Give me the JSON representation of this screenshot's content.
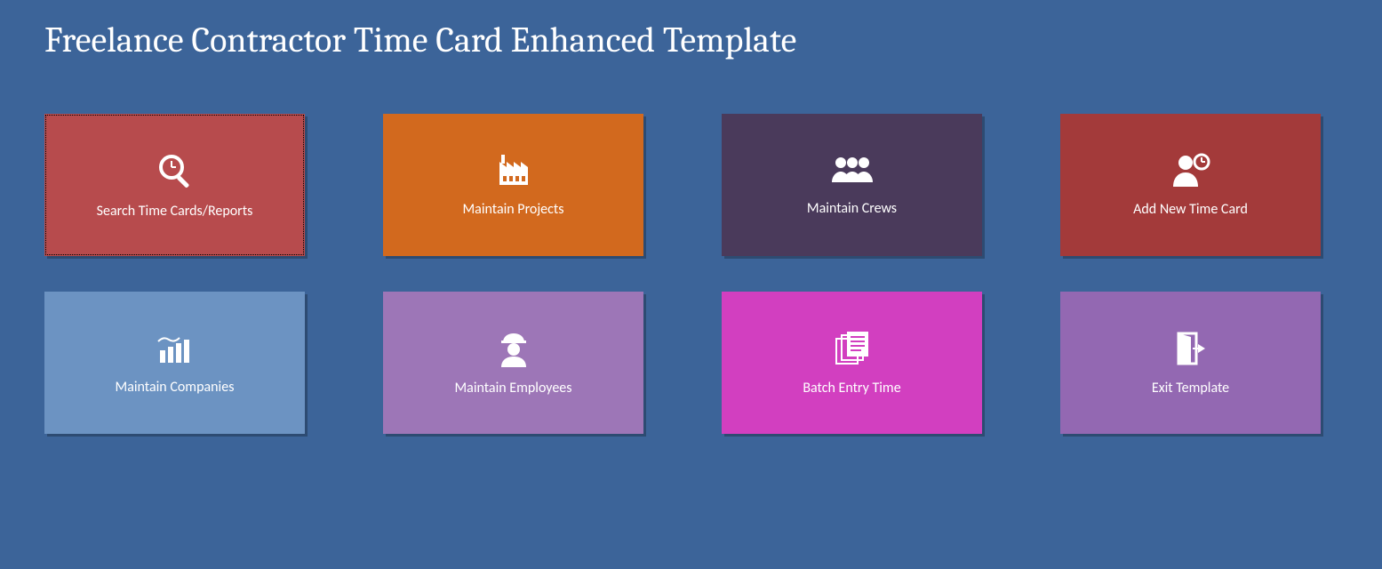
{
  "title": "Freelance Contractor Time Card Enhanced Template",
  "tiles": {
    "search": {
      "label": "Search Time Cards/Reports"
    },
    "projects": {
      "label": "Maintain Projects"
    },
    "crews": {
      "label": "Maintain Crews"
    },
    "newcard": {
      "label": "Add New Time Card"
    },
    "companies": {
      "label": "Maintain Companies"
    },
    "employees": {
      "label": "Maintain Employees"
    },
    "batch": {
      "label": "Batch Entry Time"
    },
    "exit": {
      "label": "Exit Template"
    }
  }
}
